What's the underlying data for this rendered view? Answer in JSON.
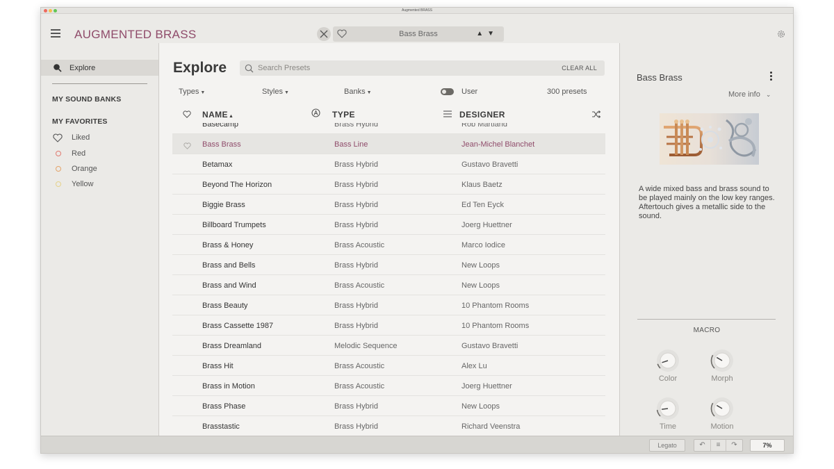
{
  "window": {
    "title": "Augmented BRASS",
    "traffic_colors": [
      "#ee6a5e",
      "#f5bf4f",
      "#62c655"
    ]
  },
  "header": {
    "app_title": "AUGMENTED BRASS",
    "current_preset": "Bass Brass",
    "accent": "#8f4b6a"
  },
  "sidebar": {
    "explore_label": "Explore",
    "sound_banks_heading": "MY SOUND BANKS",
    "favorites_heading": "MY FAVORITES",
    "favorites": [
      {
        "label": "Liked",
        "icon": "heart-icon"
      },
      {
        "label": "Red",
        "color": "#e07a70"
      },
      {
        "label": "Orange",
        "color": "#e4a46a"
      },
      {
        "label": "Yellow",
        "color": "#e6d28a"
      }
    ]
  },
  "browser": {
    "title": "Explore",
    "search_placeholder": "Search Presets",
    "clear_all": "CLEAR ALL",
    "filters": {
      "types": "Types",
      "styles": "Styles",
      "banks": "Banks"
    },
    "user_label": "User",
    "preset_count": "300 presets",
    "columns": {
      "name": "NAME",
      "type": "TYPE",
      "designer": "DESIGNER"
    },
    "rows": [
      {
        "name": "Basecamp",
        "type": "Brass Hybrid",
        "designer": "Rob Martland"
      },
      {
        "name": "Bass Brass",
        "type": "Bass Line",
        "designer": "Jean-Michel Blanchet",
        "selected": true
      },
      {
        "name": "Betamax",
        "type": "Brass Hybrid",
        "designer": "Gustavo Bravetti"
      },
      {
        "name": "Beyond The Horizon",
        "type": "Brass Hybrid",
        "designer": "Klaus Baetz"
      },
      {
        "name": "Biggie Brass",
        "type": "Brass Hybrid",
        "designer": "Ed Ten Eyck"
      },
      {
        "name": "Billboard Trumpets",
        "type": "Brass Hybrid",
        "designer": "Joerg Huettner"
      },
      {
        "name": "Brass & Honey",
        "type": "Brass Acoustic",
        "designer": "Marco Iodice"
      },
      {
        "name": "Brass and Bells",
        "type": "Brass Hybrid",
        "designer": "New Loops"
      },
      {
        "name": "Brass and Wind",
        "type": "Brass Acoustic",
        "designer": "New Loops"
      },
      {
        "name": "Brass Beauty",
        "type": "Brass Hybrid",
        "designer": "10 Phantom Rooms"
      },
      {
        "name": "Brass Cassette 1987",
        "type": "Brass Hybrid",
        "designer": "10 Phantom Rooms"
      },
      {
        "name": "Brass Dreamland",
        "type": "Melodic Sequence",
        "designer": "Gustavo Bravetti"
      },
      {
        "name": "Brass Hit",
        "type": "Brass Acoustic",
        "designer": "Alex Lu"
      },
      {
        "name": "Brass in Motion",
        "type": "Brass Acoustic",
        "designer": "Joerg Huettner"
      },
      {
        "name": "Brass Phase",
        "type": "Brass Hybrid",
        "designer": "New Loops"
      },
      {
        "name": "Brasstastic",
        "type": "Brass Hybrid",
        "designer": "Richard Veenstra"
      }
    ]
  },
  "preset_panel": {
    "name": "Bass Brass",
    "more_info": "More info",
    "description": "A wide mixed bass and brass sound to be played mainly on the low key ranges. Aftertouch gives a metallic side to the sound.",
    "macro_label": "MACRO",
    "macros": [
      {
        "label": "Color",
        "value": 0.1
      },
      {
        "label": "Morph",
        "value": 0.28
      },
      {
        "label": "Time",
        "value": 0.14
      },
      {
        "label": "Motion",
        "value": 0.28
      }
    ]
  },
  "footer": {
    "legato": "Legato",
    "cpu": "7%"
  }
}
